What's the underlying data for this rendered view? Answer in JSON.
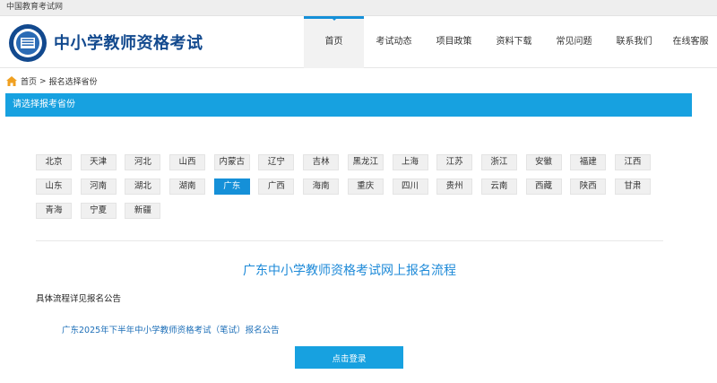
{
  "topbar": {
    "site_name": "中国教育考试网"
  },
  "header": {
    "title": "中小学教师资格考试",
    "nav": [
      {
        "label": "首页",
        "active": true
      },
      {
        "label": "考试动态"
      },
      {
        "label": "项目政策"
      },
      {
        "label": "资料下载"
      },
      {
        "label": "常见问题"
      },
      {
        "label": "联系我们"
      },
      {
        "label": "在线客服"
      }
    ]
  },
  "breadcrumb": {
    "home": "首页",
    "separator": ">",
    "current": "报名选择省份"
  },
  "banner": {
    "text": "请选择报考省份"
  },
  "provinces": [
    "北京",
    "天津",
    "河北",
    "山西",
    "内蒙古",
    "辽宁",
    "吉林",
    "黑龙江",
    "上海",
    "江苏",
    "浙江",
    "安徽",
    "福建",
    "江西",
    "山东",
    "河南",
    "湖北",
    "湖南",
    "广东",
    "广西",
    "海南",
    "重庆",
    "四川",
    "贵州",
    "云南",
    "西藏",
    "陕西",
    "甘肃",
    "青海",
    "宁夏",
    "新疆"
  ],
  "selected_province": "广东",
  "content": {
    "flow_title": "广东中小学教师资格考试网上报名流程",
    "detail_label": "具体流程详见报名公告",
    "notice_link": "广东2025年下半年中小学教师资格考试（笔试）报名公告",
    "login_button": "点击登录"
  },
  "colors": {
    "accent": "#17a1e0",
    "brand": "#12498e",
    "link": "#1d6fb8"
  }
}
